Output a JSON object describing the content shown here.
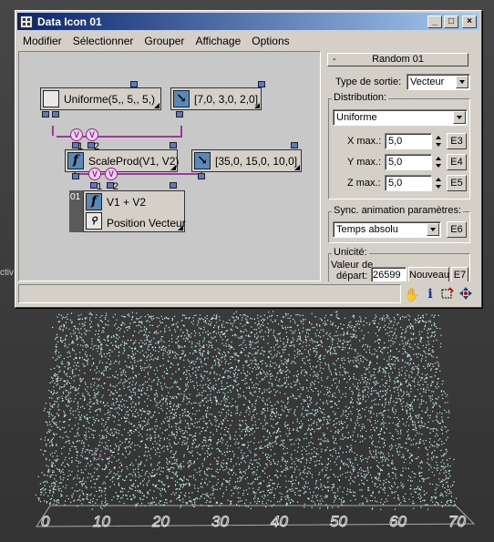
{
  "window": {
    "title": "Data Icon 01",
    "controls": {
      "minimize": "_",
      "maximize": "□",
      "close": "×"
    }
  },
  "menu": [
    "Modifier",
    "Sélectionner",
    "Grouper",
    "Affichage",
    "Options"
  ],
  "graph": {
    "nodes": {
      "uniforme": "Uniforme(5,, 5,, 5,)",
      "vec1": "[7,0, 3,0, 2,0]",
      "scaleprod": "ScaleProd(V1, V2)",
      "vec2": "[35,0, 15,0, 10,0]",
      "sum_line1": "V1 + V2",
      "sum_line2": "Position Vecteur",
      "sum_index": "01"
    },
    "port_circle": "V",
    "port_numbers": [
      "1",
      "2"
    ],
    "function_glyph": "f"
  },
  "panel": {
    "rollout_minus": "-",
    "rollout_title": "Random 01",
    "output_type_label": "Type de sortie:",
    "output_type_value": "Vecteur",
    "distribution_group": "Distribution:",
    "distribution_value": "Uniforme",
    "xmax_label": "X max.:",
    "xmax_value": "5,0",
    "xmax_button": "E3",
    "ymax_label": "Y max.:",
    "ymax_value": "5,0",
    "ymax_button": "E4",
    "zmax_label": "Z max.:",
    "zmax_value": "5,0",
    "zmax_button": "E5",
    "sync_group": "Sync. animation paramètres:",
    "sync_value": "Temps absolu",
    "sync_button": "E6",
    "unicity_group": "Unicité:",
    "seed_label_1": "Valeur de",
    "seed_label_2": "départ:",
    "seed_value": "26599",
    "new_button": "Nouveau",
    "new_extra_button": "E7"
  },
  "status_icons": [
    "hand-icon",
    "info-icon",
    "region-select-icon",
    "move-icon"
  ],
  "viewport": {
    "side_label": "ctiv",
    "axis_labels": [
      "0",
      "10",
      "20",
      "30",
      "40",
      "50",
      "60",
      "70"
    ]
  }
}
